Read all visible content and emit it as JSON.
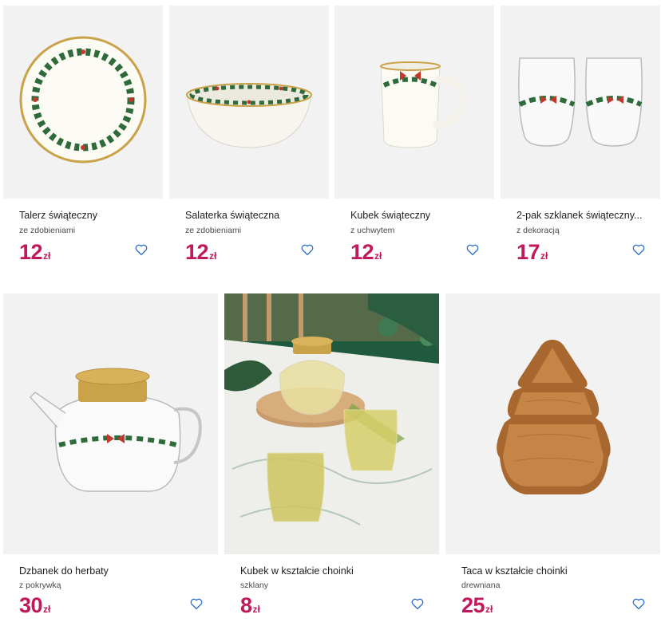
{
  "products": [
    {
      "title": "Talerz świąteczny",
      "subtitle": "ze zdobieniami",
      "price": "12",
      "currency": "zł",
      "image": "plate-photo"
    },
    {
      "title": "Salaterka świąteczna",
      "subtitle": "ze zdobieniami",
      "price": "12",
      "currency": "zł",
      "image": "bowl-photo"
    },
    {
      "title": "Kubek świąteczny",
      "subtitle": "z uchwytem",
      "price": "12",
      "currency": "zł",
      "image": "mug-photo"
    },
    {
      "title": "2-pak szklanek świąteczny...",
      "subtitle": "z dekoracją",
      "price": "17",
      "currency": "zł",
      "image": "glasses-photo"
    },
    {
      "title": "Dzbanek do herbaty",
      "subtitle": "z pokrywką",
      "price": "30",
      "currency": "zł",
      "image": "teapot-photo"
    },
    {
      "title": "Kubek w kształcie choinki",
      "subtitle": "szklany",
      "price": "8",
      "currency": "zł",
      "image": "tree-mug-photo"
    },
    {
      "title": "Taca w kształcie choinki",
      "subtitle": "drewniana",
      "price": "25",
      "currency": "zł",
      "image": "tree-tray-photo"
    }
  ],
  "colors": {
    "price": "#c2185b",
    "heart": "#2e6fd0",
    "thumb_bg": "#f2f2f2"
  },
  "icons": {
    "wishlist": "heart-outline-icon"
  }
}
